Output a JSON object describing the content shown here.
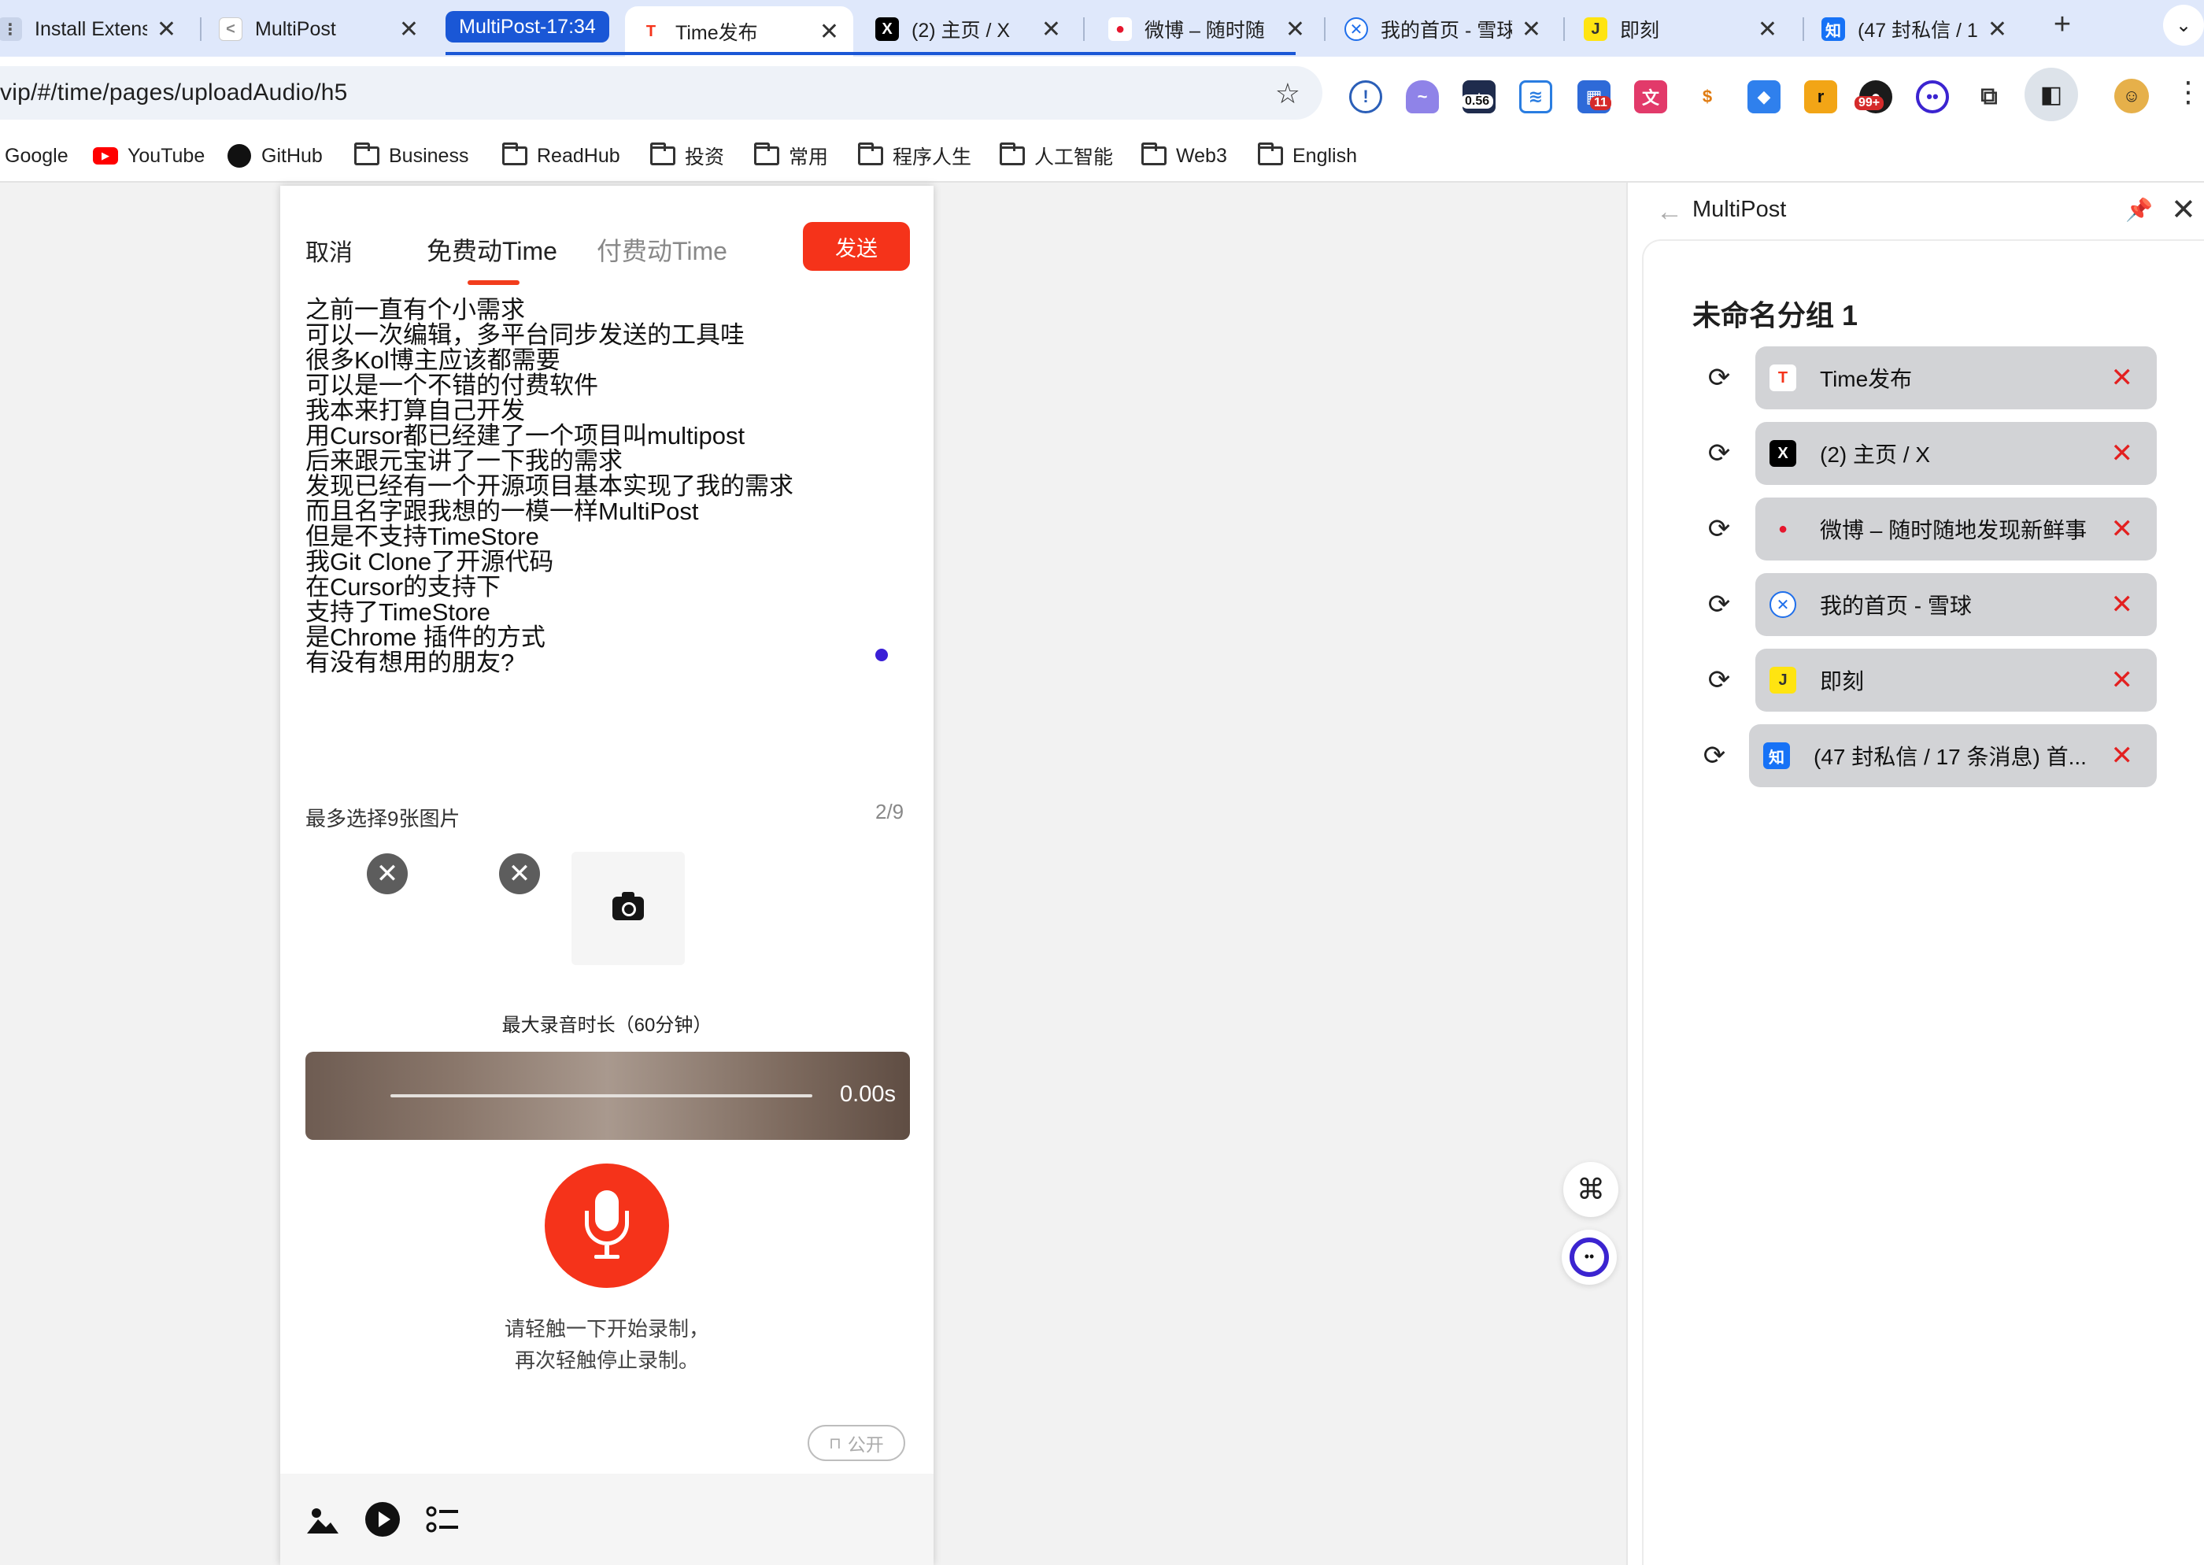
{
  "tabs": [
    {
      "label": "Install Extensi",
      "icon": "puzzle-icon"
    },
    {
      "label": "MultiPost",
      "icon": "multipost-icon"
    },
    {
      "label": "Time发布",
      "icon": "time-icon",
      "icon_text": "T"
    },
    {
      "label": "(2) 主页 / X",
      "icon": "x-icon",
      "icon_text": "X"
    },
    {
      "label": "微博 – 随时随",
      "icon": "weibo-icon"
    },
    {
      "label": "我的首页 - 雪球",
      "icon": "xueqiu-icon"
    },
    {
      "label": "即刻",
      "icon": "jike-icon",
      "icon_text": "J"
    },
    {
      "label": "(47 封私信 / 1",
      "icon": "zhihu-icon",
      "icon_text": "知"
    }
  ],
  "tab_group": {
    "label": "MultiPost-17:34"
  },
  "omnibox": {
    "url": "vip/#/time/pages/uploadAudio/h5"
  },
  "extensions": [
    {
      "icon": "shield-icon"
    },
    {
      "icon": "ghost-icon"
    },
    {
      "icon": "meter-icon",
      "label": "0.56"
    },
    {
      "icon": "inbox-icon"
    },
    {
      "icon": "grid-icon",
      "badge": "11"
    },
    {
      "icon": "translate-icon"
    },
    {
      "icon": "coin-icon"
    },
    {
      "icon": "box-icon"
    },
    {
      "icon": "r-icon",
      "label": "r"
    },
    {
      "icon": "robot-icon",
      "badge": "99+"
    },
    {
      "icon": "face-icon"
    },
    {
      "icon": "puzzle-icon"
    }
  ],
  "bookmarks": [
    {
      "label": "Google",
      "icon": "google-icon"
    },
    {
      "label": "YouTube",
      "icon": "youtube-icon"
    },
    {
      "label": "GitHub",
      "icon": "github-icon"
    },
    {
      "label": "Business",
      "icon": "folder-icon"
    },
    {
      "label": "ReadHub",
      "icon": "folder-icon"
    },
    {
      "label": "投资",
      "icon": "folder-icon"
    },
    {
      "label": "常用",
      "icon": "folder-icon"
    },
    {
      "label": "程序人生",
      "icon": "folder-icon"
    },
    {
      "label": "人工智能",
      "icon": "folder-icon"
    },
    {
      "label": "Web3",
      "icon": "folder-icon"
    },
    {
      "label": "English",
      "icon": "folder-icon"
    }
  ],
  "editor": {
    "cancel": "取消",
    "tab_free": "免费动Time",
    "tab_paid": "付费动Time",
    "send": "发送",
    "content_lines": [
      "之前一直有个小需求",
      "可以一次编辑，多平台同步发送的工具哇",
      "很多Kol博主应该都需要",
      "可以是一个不错的付费软件",
      "我本来打算自己开发",
      "用Cursor都已经建了一个项目叫multipost",
      "后来跟元宝讲了一下我的需求",
      "发现已经有一个开源项目基本实现了我的需求",
      "而且名字跟我想的一模一样MultiPost",
      "但是不支持TimeStore",
      "我Git Clone了开源代码",
      "在Cursor的支持下",
      "支持了TimeStore",
      "是Chrome 插件的方式",
      "有没有想用的朋友?"
    ],
    "image_label": "最多选择9张图片",
    "image_count": "2/9",
    "max_record": "最大录音时长（60分钟）",
    "record_time": "0.00s",
    "hint_line1": "请轻触一下开始录制，",
    "hint_line2": "再次轻触停止录制。",
    "public_label": "公开"
  },
  "sidepanel": {
    "title": "MultiPost",
    "group_name": "未命名分组 1",
    "items": [
      {
        "label": "Time发布",
        "icon": "time-icon",
        "icon_text": "T"
      },
      {
        "label": "(2) 主页 / X",
        "icon": "x-icon",
        "icon_text": "X"
      },
      {
        "label": "微博 – 随时随地发现新鲜事",
        "icon": "weibo-icon"
      },
      {
        "label": "我的首页 - 雪球",
        "icon": "xueqiu-icon"
      },
      {
        "label": "即刻",
        "icon": "jike-icon",
        "icon_text": "J"
      },
      {
        "label": "(47 封私信 / 17 条消息) 首...",
        "icon": "zhihu-icon",
        "icon_text": "知"
      }
    ]
  },
  "colors": {
    "accent": "#f5331a",
    "tab_group": "#1a57d6",
    "close_red": "#e32020"
  }
}
